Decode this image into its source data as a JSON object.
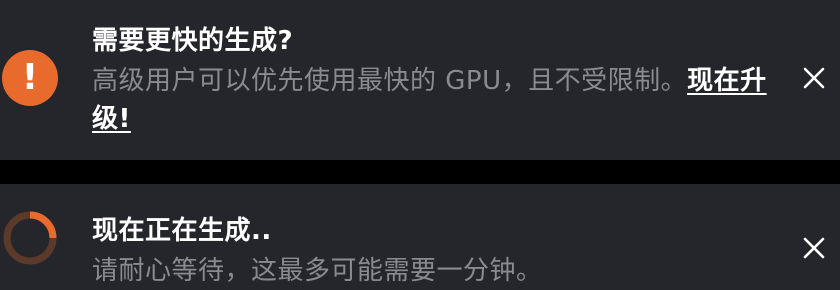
{
  "upgrade_notice": {
    "title": "需要更快的生成?",
    "body": "高级用户可以优先使用最快的 GPU，且不受限制。",
    "link_label": "现在升级!",
    "icon": "alert-icon",
    "accent_color": "#e86a2c"
  },
  "generating_notice": {
    "title": "现在正在生成..",
    "body": "请耐心等待，这最多可能需要一分钟。",
    "icon": "spinner-icon",
    "accent_color": "#e86a2c"
  },
  "colors": {
    "panel_background": "#25262b",
    "separator": "#000000",
    "title_text": "#ffffff",
    "body_text": "#8a8b90"
  }
}
